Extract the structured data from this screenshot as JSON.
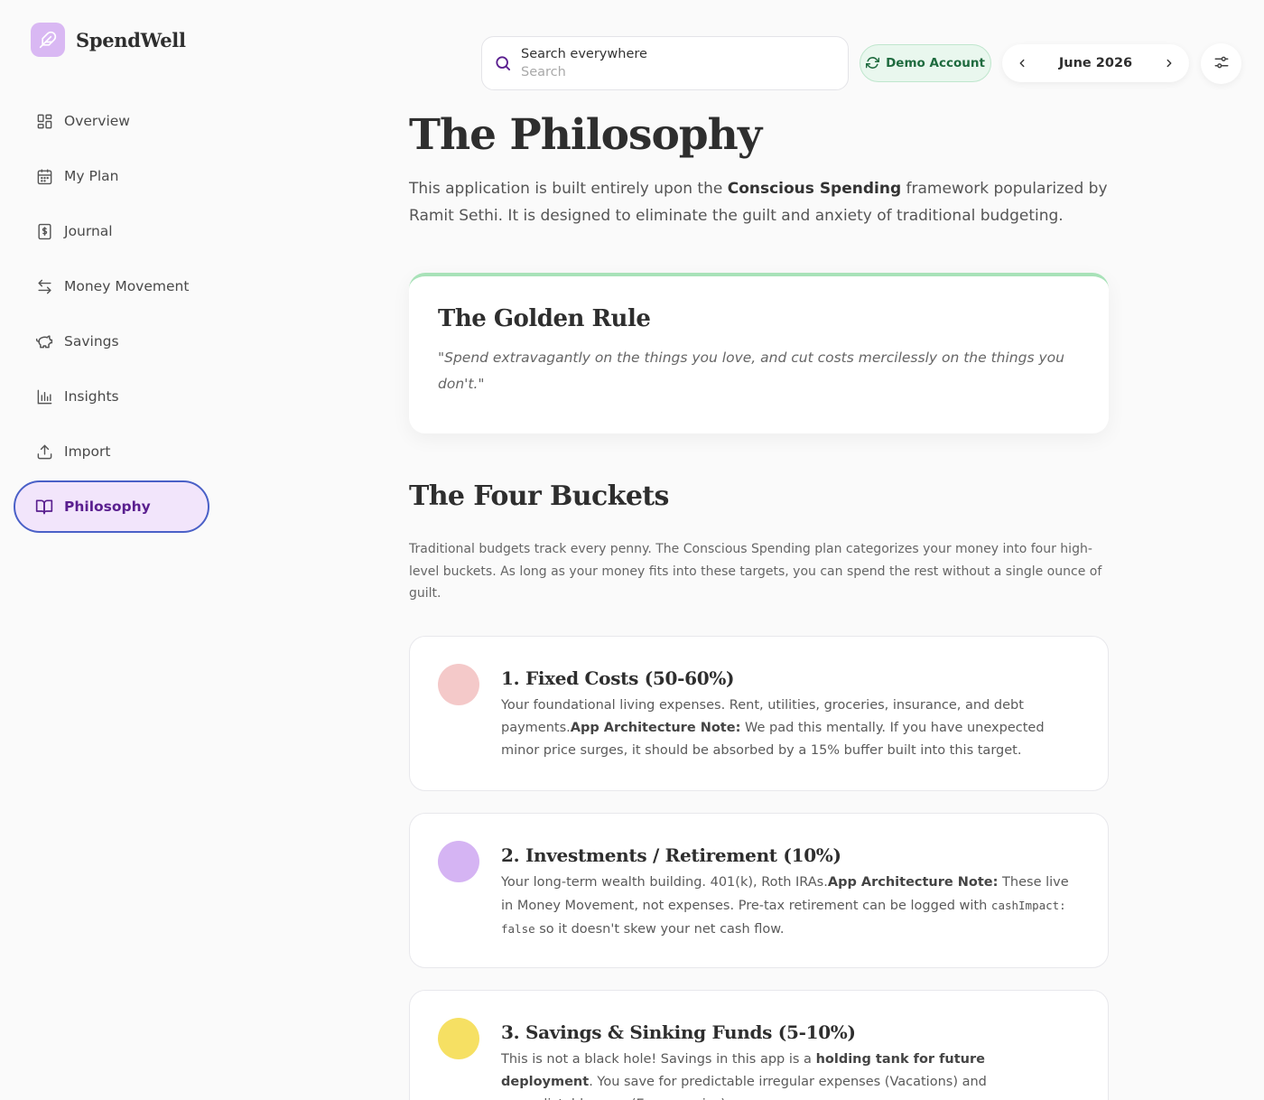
{
  "app": {
    "name": "SpendWell",
    "brand_color": "#d9b8f3"
  },
  "sidebar": {
    "items": [
      {
        "label": "Overview",
        "icon": "grid-icon"
      },
      {
        "label": "My Plan",
        "icon": "calendar-icon"
      },
      {
        "label": "Journal",
        "icon": "dollar-receipt-icon"
      },
      {
        "label": "Money Movement",
        "icon": "arrows-swap-icon"
      },
      {
        "label": "Savings",
        "icon": "piggy-bank-icon"
      },
      {
        "label": "Insights",
        "icon": "bar-chart-icon"
      },
      {
        "label": "Import",
        "icon": "upload-icon"
      },
      {
        "label": "Philosophy",
        "icon": "book-icon",
        "active": true
      }
    ]
  },
  "topbar": {
    "search": {
      "label": "Search everywhere",
      "placeholder": "Search"
    },
    "demo_badge": "Demo Account",
    "month": "June 2026"
  },
  "main": {
    "title": "The Philosophy",
    "intro": {
      "before": "This application is built entirely upon the ",
      "bold": "Conscious Spending",
      "after": " framework popularized by Ramit Sethi. It is designed to eliminate the guilt and anxiety of traditional budgeting."
    },
    "golden_rule": {
      "title": "The Golden Rule",
      "quote": "\"Spend extravagantly on the things you love, and cut costs mercilessly on the things you don't.\"",
      "accent": "#a8e2b8"
    },
    "buckets_section": {
      "title": "The Four Buckets",
      "description": "Traditional budgets track every penny. The Conscious Spending plan categorizes your money into four high-level buckets. As long as your money fits into these targets, you can spend the rest without a single ounce of guilt."
    },
    "buckets": [
      {
        "title": "1. Fixed Costs (50-60%)",
        "color": "#f4c9c9",
        "text1": "Your foundational living expenses. Rent, utilities, groceries, insurance, and debt payments.",
        "bold": "App Architecture Note:",
        "text2": " We pad this mentally. If you have unexpected minor price surges, it should be absorbed by a 15% buffer built into this target."
      },
      {
        "title": "2. Investments / Retirement (10%)",
        "color": "#d5b4f3",
        "text1": "Your long-term wealth building. 401(k), Roth IRAs.",
        "bold": "App Architecture Note:",
        "text2": " These live in Money Movement, not expenses. Pre-tax retirement can be logged with ",
        "code": "cashImpact: false",
        "text3": " so it doesn't skew your net cash flow."
      },
      {
        "title": "3. Savings & Sinking Funds (5-10%)",
        "color": "#f6e063",
        "text1": "This is not a black hole! Savings in this app is a ",
        "bold": "holding tank for future deployment",
        "text2": ". You save for predictable irregular expenses (Vacations) and unpredictable ones (Emergencies)."
      }
    ]
  }
}
